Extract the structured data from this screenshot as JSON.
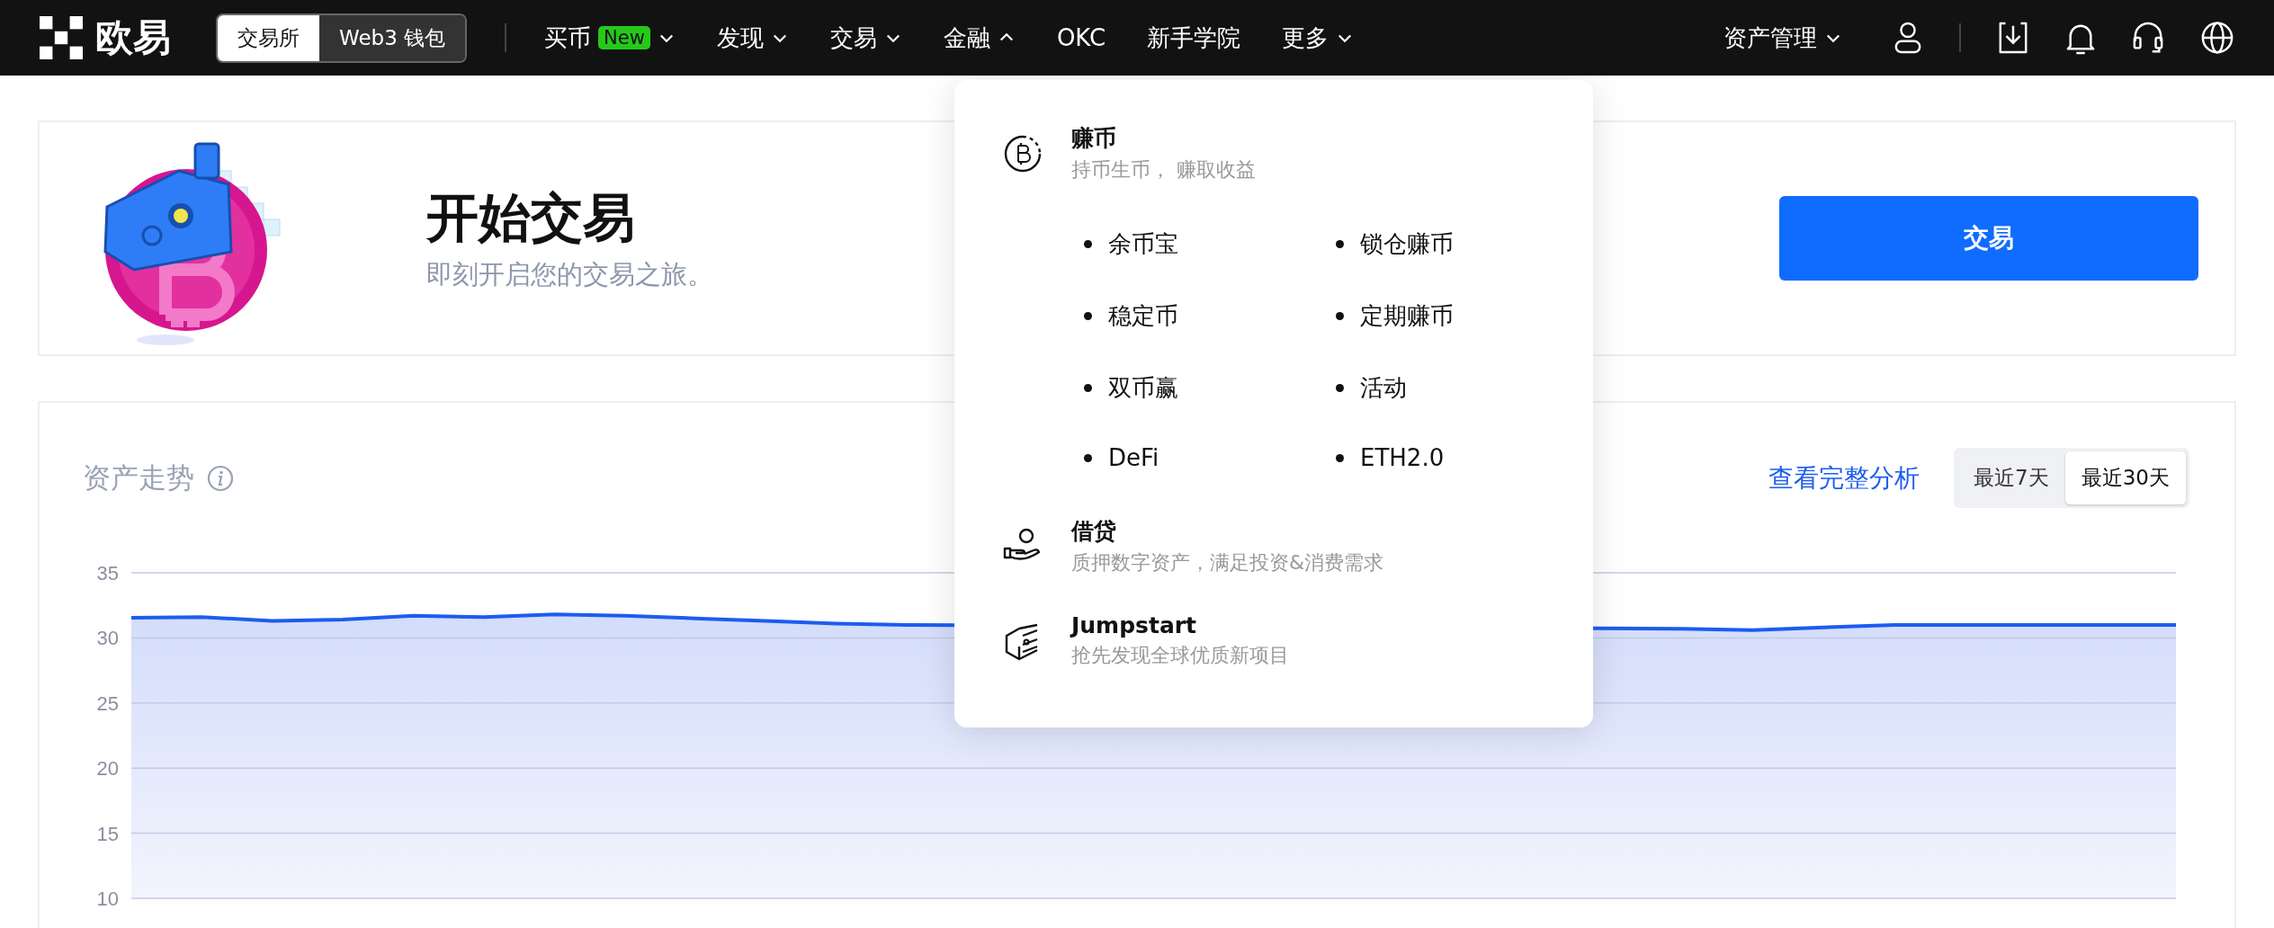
{
  "nav": {
    "logo": "欧易",
    "mode_tabs": [
      {
        "label": "交易所",
        "selected": true
      },
      {
        "label": "Web3 钱包",
        "selected": false
      }
    ],
    "items": [
      {
        "label": "买币",
        "badge": "New",
        "kind": "menu",
        "expanded": false
      },
      {
        "label": "发现",
        "kind": "menu",
        "expanded": false
      },
      {
        "label": "交易",
        "kind": "menu",
        "expanded": false
      },
      {
        "label": "金融",
        "kind": "menu",
        "expanded": true
      },
      {
        "label": "OKC",
        "kind": "link"
      },
      {
        "label": "新手学院",
        "kind": "link"
      },
      {
        "label": "更多",
        "kind": "menu",
        "expanded": false
      }
    ],
    "assets": {
      "label": "资产管理",
      "expanded": false
    }
  },
  "banner": {
    "title": "开始交易",
    "subtitle": "即刻开启您的交易之旅。",
    "button": "交易"
  },
  "asset_trend": {
    "title": "资产走势",
    "link": "查看完整分析",
    "ranges": [
      {
        "label": "最近7天",
        "selected": false
      },
      {
        "label": "最近30天",
        "selected": true
      }
    ],
    "chart_data": {
      "type": "area",
      "ylim": [
        10,
        35
      ],
      "yticks": [
        10,
        15,
        20,
        25,
        30,
        35
      ],
      "grid": true,
      "series": [
        {
          "color": "#1c5cf0",
          "values": [
            31.54,
            31.6,
            31.3,
            31.41,
            31.7,
            31.6,
            31.8,
            31.7,
            31.5,
            31.3,
            31.1,
            31.0,
            null,
            null,
            null,
            null,
            null,
            null,
            null,
            null,
            null,
            null,
            30.7,
            30.6,
            30.8,
            31.0,
            31.0,
            31.0,
            31.0,
            31.0
          ]
        }
      ]
    }
  },
  "finance_menu": {
    "sections": [
      {
        "kind": "coin",
        "title": "赚币",
        "subtitle": "持币生币， 赚取收益",
        "items": [
          "余币宝",
          "锁仓赚币",
          "稳定币",
          "定期赚币",
          "双币赢",
          "活动",
          "DeFi",
          "ETH2.0"
        ]
      },
      {
        "kind": "hand",
        "title": "借贷",
        "subtitle": "质押数字资产，满足投资&消费需求"
      },
      {
        "kind": "cube",
        "title": "Jumpstart",
        "subtitle": "抢先发现全球优质新项目"
      }
    ]
  }
}
